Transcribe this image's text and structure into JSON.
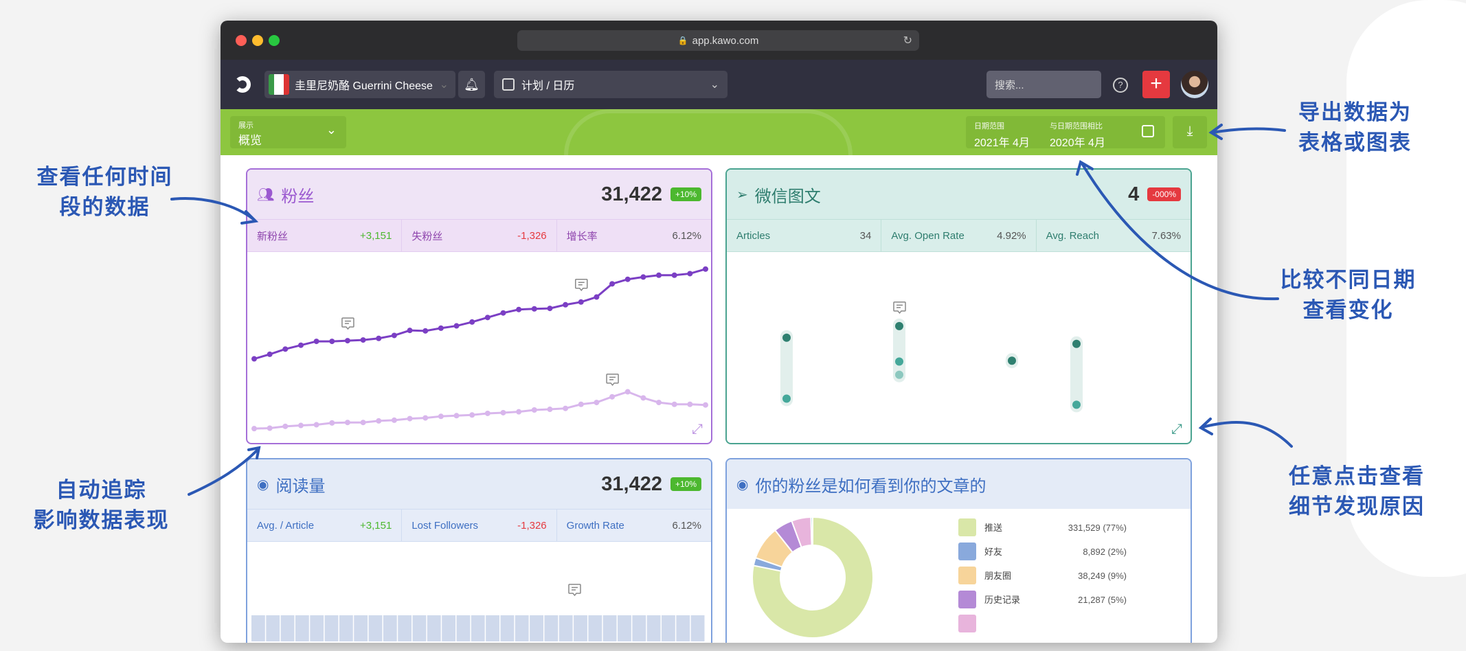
{
  "browser": {
    "url": "app.kawo.com"
  },
  "nav": {
    "brand": "圭里尼奶酪 Guerrini Cheese",
    "module": "计划 / 日历",
    "search_placeholder": "搜索..."
  },
  "toolbar": {
    "display_label": "展示",
    "display_value": "概览",
    "range_label": "日期范围",
    "range_value": "2021年 4月",
    "compare_label": "与日期范围相比",
    "compare_value": "2020年 4月"
  },
  "cards": {
    "followers": {
      "title": "粉丝",
      "total": "31,422",
      "change": "+10%",
      "stats": [
        {
          "label": "新粉丝",
          "value": "+3,151"
        },
        {
          "label": "失粉丝",
          "value": "-1,326"
        },
        {
          "label": "增长率",
          "value": "6.12%"
        }
      ]
    },
    "articles": {
      "title": "微信图文",
      "total": "4",
      "change": "-000%",
      "stats": [
        {
          "label": "Articles",
          "value": "34"
        },
        {
          "label": "Avg. Open Rate",
          "value": "4.92%"
        },
        {
          "label": "Avg. Reach",
          "value": "7.63%"
        }
      ]
    },
    "reads": {
      "title": "阅读量",
      "total": "31,422",
      "change": "+10%",
      "stats": [
        {
          "label": "Avg. / Article",
          "value": "+3,151"
        },
        {
          "label": "Lost Followers",
          "value": "-1,326"
        },
        {
          "label": "Growth Rate",
          "value": "6.12%"
        }
      ]
    },
    "sources": {
      "title": "你的粉丝是如何看到你的文章的"
    }
  },
  "colors": {
    "accent_green": "#8dc63f",
    "positive": "#4cb82f",
    "negative": "#e5393f",
    "purple": "#7b3fc4",
    "purple_light": "#d8b6ec",
    "teal": "#2f8070",
    "blue": "#3e6fc2"
  },
  "annotations": {
    "a1": [
      "查看任何时间",
      "段的数据"
    ],
    "a2": [
      "自动追踪",
      "影响数据表现"
    ],
    "a3": [
      "导出数据为",
      "表格或图表"
    ],
    "a4": [
      "比较不同日期",
      "查看变化"
    ],
    "a5": [
      "任意点击查看",
      "细节发现原因"
    ]
  },
  "chart_data": [
    {
      "type": "line",
      "title": "粉丝",
      "ylim": [
        40,
        880
      ],
      "series": [
        {
          "name": "current",
          "values": [
            410,
            430,
            453,
            470,
            487,
            487,
            490,
            493,
            500,
            513,
            535,
            533,
            545,
            555,
            572,
            592,
            612,
            627,
            630,
            632,
            648,
            660,
            682,
            740,
            760,
            770,
            778,
            778,
            785,
            805
          ]
        },
        {
          "name": "compare",
          "values": [
            103,
            105,
            113,
            117,
            120,
            128,
            130,
            130,
            137,
            140,
            147,
            150,
            157,
            160,
            163,
            170,
            173,
            177,
            185,
            188,
            192,
            210,
            218,
            243,
            265,
            238,
            218,
            210,
            210,
            207
          ]
        }
      ],
      "comments_at": [
        6,
        21,
        23
      ]
    },
    {
      "type": "scatter",
      "title": "微信图文",
      "ylim": [
        40,
        880
      ],
      "groups": [
        [
          503,
          235
        ],
        [
          554,
          398,
          340
        ],
        [
          402
        ],
        [
          476,
          208
        ]
      ]
    },
    {
      "type": "pie",
      "title": "你的粉丝是如何看到你的文章的",
      "slices": [
        {
          "label": "推送",
          "value": 331529,
          "display": "331,529 (77%)",
          "color": "#d9e7a8"
        },
        {
          "label": "好友",
          "value": 8892,
          "display": "8,892 (2%)",
          "color": "#89a9dc"
        },
        {
          "label": "朋友圈",
          "value": 38249,
          "display": "38,249 (9%)",
          "color": "#f7d49a"
        },
        {
          "label": "历史记录",
          "value": 21287,
          "display": "21,287 (5%)",
          "color": "#b48ad6"
        },
        {
          "label": "",
          "value": 22000,
          "display": "",
          "color": "#e8b4dc"
        },
        {
          "label": "",
          "value": 2000,
          "display": "",
          "color": "#a9d6e0"
        }
      ]
    },
    {
      "type": "bar",
      "title": "阅读量",
      "values": [
        1,
        1,
        1,
        1,
        1,
        1,
        1,
        1,
        1,
        1,
        1,
        1,
        1,
        1,
        1,
        1,
        1,
        1,
        1,
        1,
        1,
        1,
        1,
        1,
        1,
        1,
        1,
        1,
        1,
        1,
        1
      ]
    }
  ]
}
